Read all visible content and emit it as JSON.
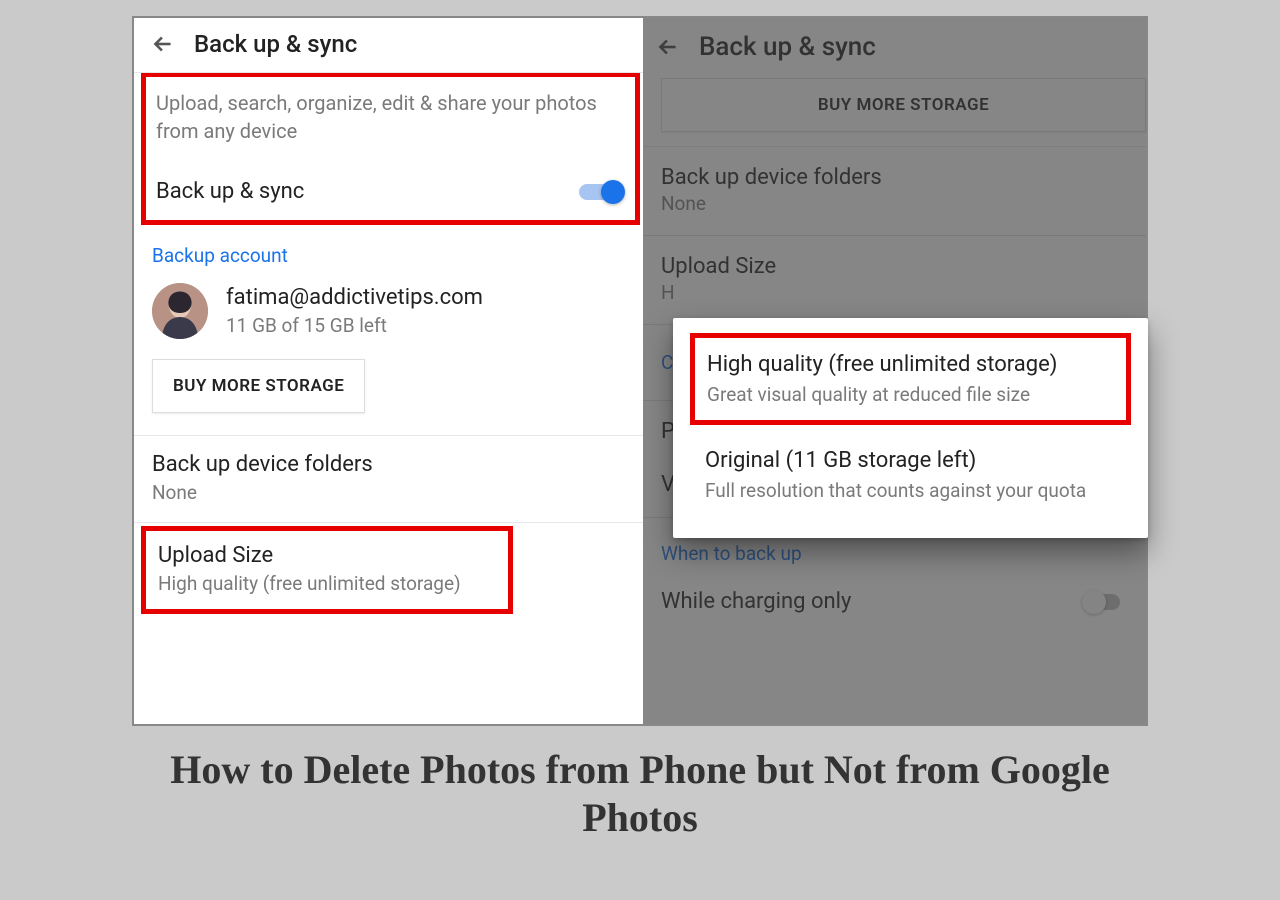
{
  "left": {
    "title": "Back up & sync",
    "desc": "Upload, search, organize, edit & share your photos from any device",
    "toggle_label": "Back up & sync",
    "account_header": "Backup account",
    "account_email": "fatima@addictivetips.com",
    "account_storage": "11 GB of 15 GB left",
    "buy_button": "BUY MORE STORAGE",
    "device_folders_label": "Back up device folders",
    "device_folders_value": "None",
    "upload_size_label": "Upload Size",
    "upload_size_value": "High quality (free unlimited storage)"
  },
  "right": {
    "title": "Back up & sync",
    "buy_button": "BUY MORE STORAGE",
    "device_folders_label": "Back up device folders",
    "device_folders_value": "None",
    "upload_size_label": "Upload Size",
    "upload_size_value": "H",
    "cellular_label": "C",
    "photos_label": "P",
    "videos_label": "Videos",
    "when_label": "When to back up",
    "charging_label": "While charging only"
  },
  "dialog": {
    "opt1_title": "High quality (free unlimited storage)",
    "opt1_sub": "Great visual quality at reduced file size",
    "opt2_title": "Original (11 GB storage left)",
    "opt2_sub": "Full resolution that counts against your quota"
  },
  "caption": "How to Delete Photos from Phone but Not from Google Photos"
}
